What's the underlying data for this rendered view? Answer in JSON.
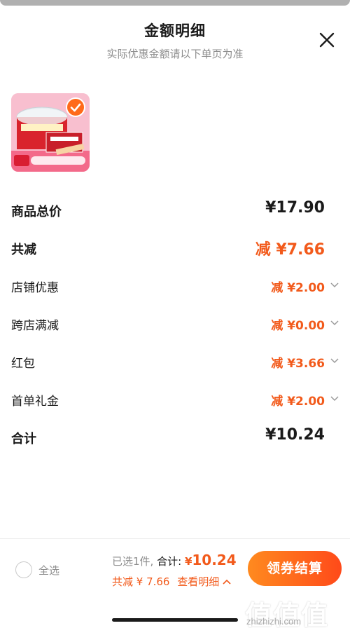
{
  "header": {
    "title": "金额明细",
    "subtitle": "实际优惠金额请以下单页为准"
  },
  "product": {
    "icon": "snack-box-image",
    "selected": true
  },
  "rows": [
    {
      "label": "商品总价",
      "value": "¥17.90",
      "bold": true,
      "orange": false,
      "chevron": false
    },
    {
      "label": "共减",
      "value": "减 ¥7.66",
      "bold": true,
      "orange": true,
      "chevron": false
    },
    {
      "label": "店铺优惠",
      "value": "减 ¥2.00",
      "bold": false,
      "orange": true,
      "chevron": true
    },
    {
      "label": "跨店满减",
      "value": "减 ¥0.00",
      "bold": false,
      "orange": true,
      "chevron": true
    },
    {
      "label": "红包",
      "value": "减 ¥3.66",
      "bold": false,
      "orange": true,
      "chevron": true
    },
    {
      "label": "首单礼金",
      "value": "减 ¥2.00",
      "bold": false,
      "orange": true,
      "chevron": true
    },
    {
      "label": "合计",
      "value": "¥10.24",
      "bold": true,
      "orange": false,
      "chevron": false
    }
  ],
  "bottom": {
    "select_all": "全选",
    "selected_count": "已选1件,",
    "total_label": "合计:",
    "total_amount": "10.24",
    "total_yen": "¥",
    "discount_summary": "共减 ¥ 7.66",
    "view_detail": "查看明细",
    "checkout": "领券结算"
  },
  "watermark": {
    "brand": "值值值",
    "url": "zhizhizhi.com"
  },
  "colors": {
    "accent": "#f25a1b",
    "checkout_start": "#ff8a1f",
    "checkout_end": "#ff4a1a"
  }
}
